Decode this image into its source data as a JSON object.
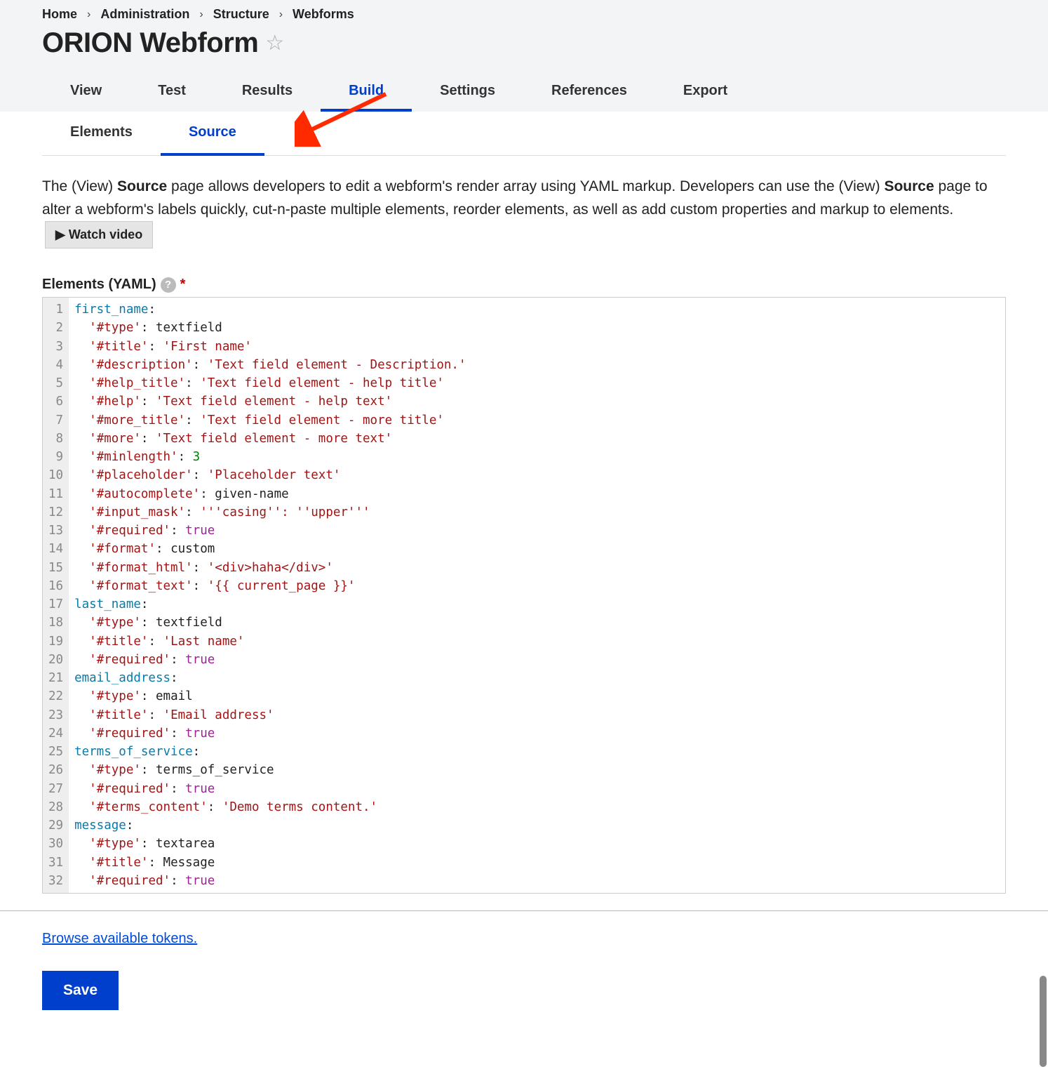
{
  "breadcrumb": [
    "Home",
    "Administration",
    "Structure",
    "Webforms"
  ],
  "title": "ORION Webform",
  "primary_tabs": [
    {
      "label": "View",
      "active": false
    },
    {
      "label": "Test",
      "active": false
    },
    {
      "label": "Results",
      "active": false
    },
    {
      "label": "Build",
      "active": true
    },
    {
      "label": "Settings",
      "active": false
    },
    {
      "label": "References",
      "active": false
    },
    {
      "label": "Export",
      "active": false
    }
  ],
  "sub_tabs": [
    {
      "label": "Elements",
      "active": false
    },
    {
      "label": "Source",
      "active": true
    }
  ],
  "description_parts": {
    "p1": "The (View) ",
    "p2_strong": "Source",
    "p3": " page allows developers to edit a webform's render array using YAML markup. Developers can use the (View) ",
    "p4_strong": "Source",
    "p5": " page to alter a webform's labels quickly, cut-n-paste multiple elements, reorder elements, as well as add custom properties and markup to elements. "
  },
  "watch_video_label": "▶ Watch video",
  "yaml_label": "Elements (YAML)",
  "yaml_lines": [
    [
      {
        "t": "first_name",
        "c": "key"
      },
      {
        "t": ":",
        "c": "plain"
      }
    ],
    [
      {
        "t": "  ",
        "c": "plain"
      },
      {
        "t": "'#type'",
        "c": "prop"
      },
      {
        "t": ": ",
        "c": "plain"
      },
      {
        "t": "textfield",
        "c": "plain"
      }
    ],
    [
      {
        "t": "  ",
        "c": "plain"
      },
      {
        "t": "'#title'",
        "c": "prop"
      },
      {
        "t": ": ",
        "c": "plain"
      },
      {
        "t": "'First name'",
        "c": "str"
      }
    ],
    [
      {
        "t": "  ",
        "c": "plain"
      },
      {
        "t": "'#description'",
        "c": "prop"
      },
      {
        "t": ": ",
        "c": "plain"
      },
      {
        "t": "'Text field element - Description.'",
        "c": "str"
      }
    ],
    [
      {
        "t": "  ",
        "c": "plain"
      },
      {
        "t": "'#help_title'",
        "c": "prop"
      },
      {
        "t": ": ",
        "c": "plain"
      },
      {
        "t": "'Text field element - help title'",
        "c": "str"
      }
    ],
    [
      {
        "t": "  ",
        "c": "plain"
      },
      {
        "t": "'#help'",
        "c": "prop"
      },
      {
        "t": ": ",
        "c": "plain"
      },
      {
        "t": "'Text field element - help text'",
        "c": "str"
      }
    ],
    [
      {
        "t": "  ",
        "c": "plain"
      },
      {
        "t": "'#more_title'",
        "c": "prop"
      },
      {
        "t": ": ",
        "c": "plain"
      },
      {
        "t": "'Text field element - more title'",
        "c": "str"
      }
    ],
    [
      {
        "t": "  ",
        "c": "plain"
      },
      {
        "t": "'#more'",
        "c": "prop"
      },
      {
        "t": ": ",
        "c": "plain"
      },
      {
        "t": "'Text field element - more text'",
        "c": "str"
      }
    ],
    [
      {
        "t": "  ",
        "c": "plain"
      },
      {
        "t": "'#minlength'",
        "c": "prop"
      },
      {
        "t": ": ",
        "c": "plain"
      },
      {
        "t": "3",
        "c": "num"
      }
    ],
    [
      {
        "t": "  ",
        "c": "plain"
      },
      {
        "t": "'#placeholder'",
        "c": "prop"
      },
      {
        "t": ": ",
        "c": "plain"
      },
      {
        "t": "'Placeholder text'",
        "c": "str"
      }
    ],
    [
      {
        "t": "  ",
        "c": "plain"
      },
      {
        "t": "'#autocomplete'",
        "c": "prop"
      },
      {
        "t": ": ",
        "c": "plain"
      },
      {
        "t": "given-name",
        "c": "plain"
      }
    ],
    [
      {
        "t": "  ",
        "c": "plain"
      },
      {
        "t": "'#input_mask'",
        "c": "prop"
      },
      {
        "t": ": ",
        "c": "plain"
      },
      {
        "t": "'''casing'': ''upper'''",
        "c": "str"
      }
    ],
    [
      {
        "t": "  ",
        "c": "plain"
      },
      {
        "t": "'#required'",
        "c": "prop"
      },
      {
        "t": ": ",
        "c": "plain"
      },
      {
        "t": "true",
        "c": "bool"
      }
    ],
    [
      {
        "t": "  ",
        "c": "plain"
      },
      {
        "t": "'#format'",
        "c": "prop"
      },
      {
        "t": ": ",
        "c": "plain"
      },
      {
        "t": "custom",
        "c": "plain"
      }
    ],
    [
      {
        "t": "  ",
        "c": "plain"
      },
      {
        "t": "'#format_html'",
        "c": "prop"
      },
      {
        "t": ": ",
        "c": "plain"
      },
      {
        "t": "'<div>haha</div>'",
        "c": "str"
      }
    ],
    [
      {
        "t": "  ",
        "c": "plain"
      },
      {
        "t": "'#format_text'",
        "c": "prop"
      },
      {
        "t": ": ",
        "c": "plain"
      },
      {
        "t": "'{{ current_page }}'",
        "c": "str"
      }
    ],
    [
      {
        "t": "last_name",
        "c": "key"
      },
      {
        "t": ":",
        "c": "plain"
      }
    ],
    [
      {
        "t": "  ",
        "c": "plain"
      },
      {
        "t": "'#type'",
        "c": "prop"
      },
      {
        "t": ": ",
        "c": "plain"
      },
      {
        "t": "textfield",
        "c": "plain"
      }
    ],
    [
      {
        "t": "  ",
        "c": "plain"
      },
      {
        "t": "'#title'",
        "c": "prop"
      },
      {
        "t": ": ",
        "c": "plain"
      },
      {
        "t": "'Last name'",
        "c": "str"
      }
    ],
    [
      {
        "t": "  ",
        "c": "plain"
      },
      {
        "t": "'#required'",
        "c": "prop"
      },
      {
        "t": ": ",
        "c": "plain"
      },
      {
        "t": "true",
        "c": "bool"
      }
    ],
    [
      {
        "t": "email_address",
        "c": "key"
      },
      {
        "t": ":",
        "c": "plain"
      }
    ],
    [
      {
        "t": "  ",
        "c": "plain"
      },
      {
        "t": "'#type'",
        "c": "prop"
      },
      {
        "t": ": ",
        "c": "plain"
      },
      {
        "t": "email",
        "c": "plain"
      }
    ],
    [
      {
        "t": "  ",
        "c": "plain"
      },
      {
        "t": "'#title'",
        "c": "prop"
      },
      {
        "t": ": ",
        "c": "plain"
      },
      {
        "t": "'Email address'",
        "c": "str"
      }
    ],
    [
      {
        "t": "  ",
        "c": "plain"
      },
      {
        "t": "'#required'",
        "c": "prop"
      },
      {
        "t": ": ",
        "c": "plain"
      },
      {
        "t": "true",
        "c": "bool"
      }
    ],
    [
      {
        "t": "terms_of_service",
        "c": "key"
      },
      {
        "t": ":",
        "c": "plain"
      }
    ],
    [
      {
        "t": "  ",
        "c": "plain"
      },
      {
        "t": "'#type'",
        "c": "prop"
      },
      {
        "t": ": ",
        "c": "plain"
      },
      {
        "t": "terms_of_service",
        "c": "plain"
      }
    ],
    [
      {
        "t": "  ",
        "c": "plain"
      },
      {
        "t": "'#required'",
        "c": "prop"
      },
      {
        "t": ": ",
        "c": "plain"
      },
      {
        "t": "true",
        "c": "bool"
      }
    ],
    [
      {
        "t": "  ",
        "c": "plain"
      },
      {
        "t": "'#terms_content'",
        "c": "prop"
      },
      {
        "t": ": ",
        "c": "plain"
      },
      {
        "t": "'Demo terms content.'",
        "c": "str"
      }
    ],
    [
      {
        "t": "message",
        "c": "key"
      },
      {
        "t": ":",
        "c": "plain"
      }
    ],
    [
      {
        "t": "  ",
        "c": "plain"
      },
      {
        "t": "'#type'",
        "c": "prop"
      },
      {
        "t": ": ",
        "c": "plain"
      },
      {
        "t": "textarea",
        "c": "plain"
      }
    ],
    [
      {
        "t": "  ",
        "c": "plain"
      },
      {
        "t": "'#title'",
        "c": "prop"
      },
      {
        "t": ": ",
        "c": "plain"
      },
      {
        "t": "Message",
        "c": "plain"
      }
    ],
    [
      {
        "t": "  ",
        "c": "plain"
      },
      {
        "t": "'#required'",
        "c": "prop"
      },
      {
        "t": ": ",
        "c": "plain"
      },
      {
        "t": "true",
        "c": "bool"
      }
    ]
  ],
  "tokens_link": "Browse available tokens.",
  "save_label": "Save"
}
